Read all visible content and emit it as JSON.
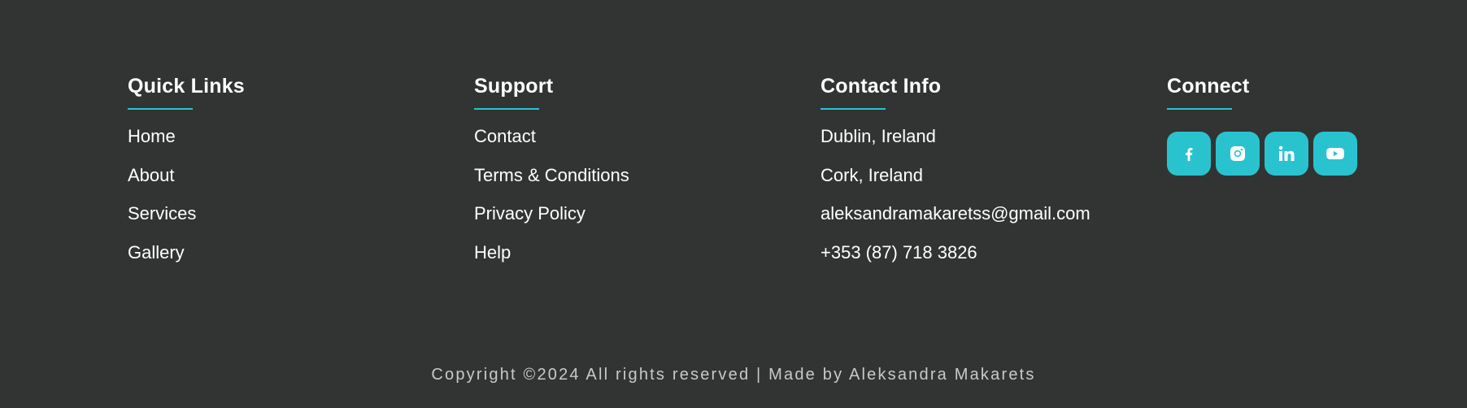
{
  "footer": {
    "columns": [
      {
        "title": "Quick Links",
        "items": [
          "Home",
          "About",
          "Services",
          "Gallery"
        ]
      },
      {
        "title": "Support",
        "items": [
          "Contact",
          "Terms & Conditions",
          "Privacy Policy",
          "Help"
        ]
      },
      {
        "title": "Contact Info",
        "items": [
          "Dublin, Ireland",
          "Cork, Ireland",
          "aleksandramakaretss@gmail.com",
          "+353 (87) 718 3826"
        ]
      },
      {
        "title": "Connect"
      }
    ],
    "social": [
      {
        "icon": "facebook-icon"
      },
      {
        "icon": "instagram-icon"
      },
      {
        "icon": "linkedin-icon"
      },
      {
        "icon": "youtube-icon"
      }
    ],
    "copyright": "Copyright ©2024 All rights reserved | Made by Aleksandra Makarets"
  },
  "colors": {
    "background": "#323433",
    "accent": "#29c3cf",
    "text": "#ffffff",
    "copyright_text": "#c9c9c9"
  }
}
